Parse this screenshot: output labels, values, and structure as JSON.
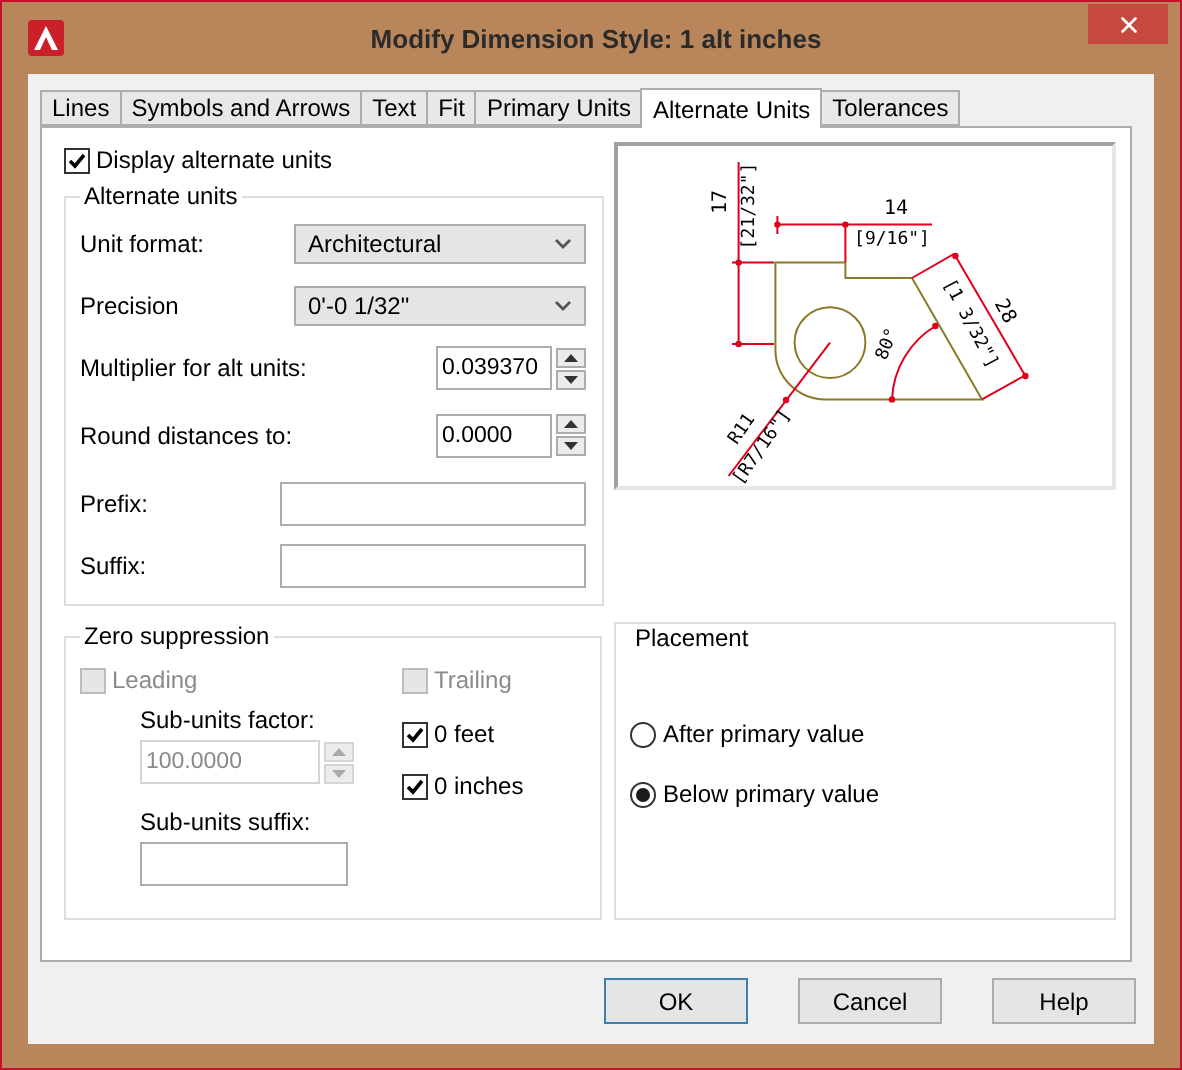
{
  "window": {
    "title": "Modify Dimension Style: 1 alt inches"
  },
  "tabs": [
    {
      "label": "Lines",
      "selected": false
    },
    {
      "label": "Symbols and Arrows",
      "selected": false
    },
    {
      "label": "Text",
      "selected": false
    },
    {
      "label": "Fit",
      "selected": false
    },
    {
      "label": "Primary Units",
      "selected": false
    },
    {
      "label": "Alternate Units",
      "selected": true
    },
    {
      "label": "Tolerances",
      "selected": false
    }
  ],
  "display_alternate_units": {
    "label": "Display alternate units",
    "checked": true
  },
  "alternate_units": {
    "title": "Alternate units",
    "fields": [
      {
        "kind": "dropdown",
        "label": "Unit format:",
        "value": "Architectural"
      },
      {
        "kind": "dropdown",
        "label": "Precision",
        "value": "0'-0 1/32\""
      },
      {
        "kind": "spinner",
        "label": "Multiplier for alt units:",
        "value": "0.039370"
      },
      {
        "kind": "spinner",
        "label": "Round distances  to:",
        "value": "0.0000"
      },
      {
        "kind": "text",
        "label": "Prefix:"
      },
      {
        "kind": "text",
        "label": "Suffix:"
      }
    ]
  },
  "preview": {
    "labels": [
      "17",
      "[21/32\"]",
      "14",
      "[9/16\"]",
      "28",
      "[1 3/32\"]",
      "80°",
      "R11",
      "[R7/16\"]"
    ]
  },
  "zero_suppression": {
    "title": "Zero suppression",
    "leading": {
      "label": "Leading",
      "checked": false,
      "disabled": true
    },
    "trailing": {
      "label": "Trailing",
      "checked": false,
      "disabled": true
    },
    "sub_units_factor": {
      "label": "Sub-units factor:",
      "value": "100.0000",
      "disabled": true
    },
    "sub_units_suffix": {
      "label": "Sub-units suffix:"
    },
    "feet": {
      "label": "0 feet",
      "checked": true,
      "disabled": false
    },
    "inches": {
      "label": "0 inches",
      "checked": true,
      "disabled": false
    }
  },
  "placement": {
    "title": "Placement",
    "options": [
      {
        "label": "After primary value",
        "selected": false
      },
      {
        "label": "Below primary value",
        "selected": true
      }
    ]
  },
  "buttons": [
    {
      "label": "OK",
      "default": true
    },
    {
      "label": "Cancel",
      "default": false
    },
    {
      "label": "Help",
      "default": false
    }
  ]
}
